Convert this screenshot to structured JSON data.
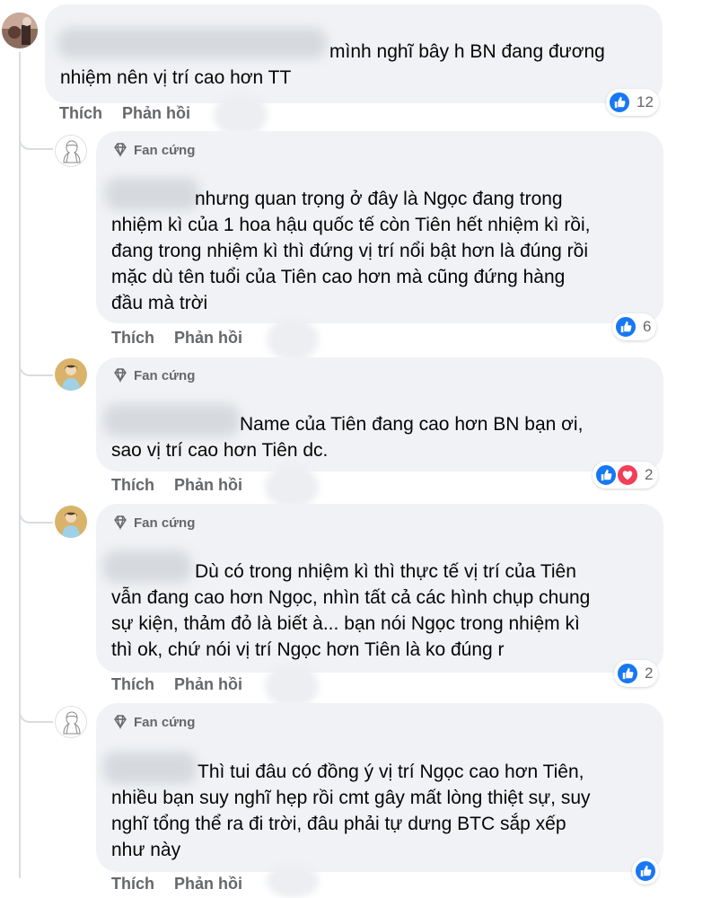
{
  "badge_label": "Fan cứng",
  "action_like": "Thích",
  "action_reply": "Phản hồi",
  "colors": {
    "like_blue": "#1877f2",
    "love_red": "#f33e58",
    "bubble_bg": "#f0f2f5",
    "meta_grey": "#65676b"
  },
  "comments": [
    {
      "text": "mình nghĩ bây h BN đang đương\nnhiệm nên vị trí cao hơn TT",
      "reaction_icons": [
        "like-icon"
      ],
      "reaction_count": "12",
      "has_badge": false
    },
    {
      "text": "nhưng quan trọng ở đây là Ngọc đang trong\nnhiệm kì của 1 hoa hậu quốc tế còn Tiên hết nhiệm kì rồi,\nđang trong nhiệm kì thì đứng vị trí nổi bật hơn là đúng rồi\nmặc dù tên tuổi của Tiên cao hơn mà cũng đứng hàng\nđầu mà trời",
      "reaction_icons": [
        "like-icon"
      ],
      "reaction_count": "6",
      "has_badge": true
    },
    {
      "text": "Name của Tiên đang cao hơn BN bạn ơi,\nsao vị trí cao hơn Tiên dc.",
      "reaction_icons": [
        "like-icon",
        "love-icon"
      ],
      "reaction_count": "2",
      "has_badge": true
    },
    {
      "text": "Dù có trong nhiệm kì thì thực tế vị trí của Tiên\nvẫn đang cao hơn Ngọc, nhìn tất cả các hình chụp chung\nsự kiện, thảm đỏ là biết à... bạn nói Ngọc trong nhiệm kì\nthì ok, chứ nói vị trí Ngọc hơn Tiên là ko đúng r",
      "reaction_icons": [
        "like-icon"
      ],
      "reaction_count": "2",
      "has_badge": true
    },
    {
      "text": "Thì tui đâu có đồng ý vị trí Ngọc cao hơn Tiên,\nnhiều bạn suy nghĩ hẹp rồi cmt gây mất lòng thiệt sự, suy\nnghĩ tổng thể ra đi trời, đâu phải tự dưng BTC sắp xếp\nnhư này",
      "reaction_icons": [
        "like-icon"
      ],
      "reaction_count": "",
      "has_badge": true
    }
  ]
}
